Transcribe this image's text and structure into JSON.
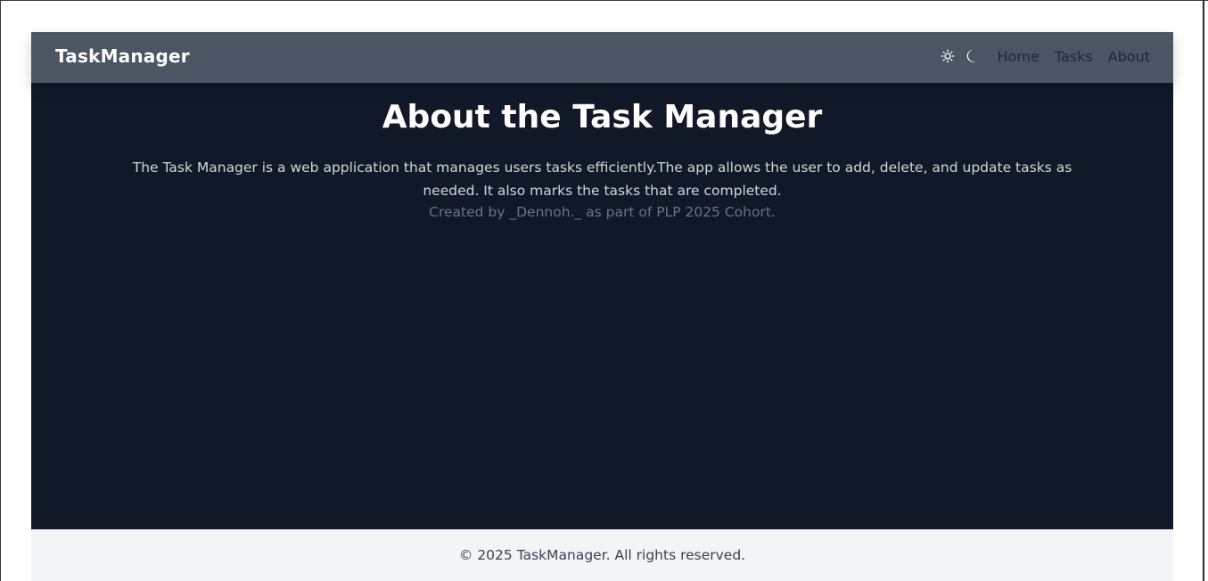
{
  "navbar": {
    "brand": "TaskManager",
    "theme_icons": [
      "sun-icon",
      "moon-icon"
    ],
    "links": [
      "Home",
      "Tasks",
      "About"
    ]
  },
  "about": {
    "title": "About the Task Manager",
    "description": "The Task Manager is a web application that manages users tasks efficiently.The app allows the user to add, delete, and update tasks as needed. It also marks the tasks that are completed.",
    "credit": "Created by _Dennoh._ as part of PLP 2025 Cohort."
  },
  "footer": {
    "text": "© 2025 TaskManager. All rights reserved."
  },
  "colors": {
    "navbar_bg": "#4b5563",
    "page_bg": "#111827",
    "footer_bg": "#f3f4f6"
  }
}
